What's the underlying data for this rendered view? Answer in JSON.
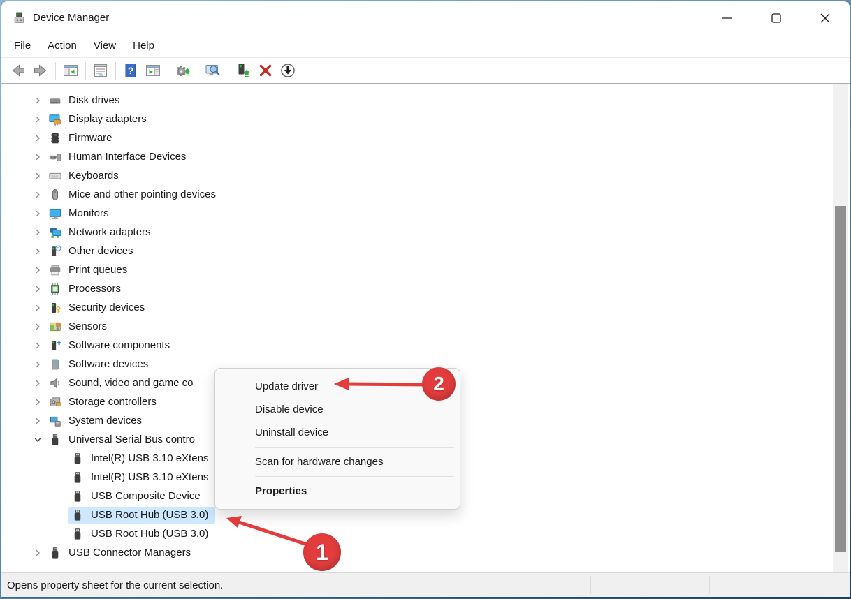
{
  "window": {
    "title": "Device Manager",
    "controls": [
      {
        "name": "minimize"
      },
      {
        "name": "maximize"
      },
      {
        "name": "close"
      }
    ]
  },
  "menu_bar": {
    "items": [
      {
        "label": "File"
      },
      {
        "label": "Action"
      },
      {
        "label": "View"
      },
      {
        "label": "Help"
      }
    ]
  },
  "toolbar": {
    "buttons": [
      {
        "name": "back"
      },
      {
        "name": "forward"
      },
      {
        "sep": true
      },
      {
        "name": "show-console-tree"
      },
      {
        "sep": true
      },
      {
        "name": "properties"
      },
      {
        "sep": true
      },
      {
        "name": "help"
      },
      {
        "name": "show-action-pane"
      },
      {
        "sep": true
      },
      {
        "name": "update-driver-software"
      },
      {
        "sep": true
      },
      {
        "name": "scan-hardware-changes"
      },
      {
        "sep": true
      },
      {
        "name": "update-device-driver"
      },
      {
        "name": "uninstall-device"
      },
      {
        "name": "disable-device"
      }
    ]
  },
  "tree": {
    "items": [
      {
        "label": "Disk drives",
        "icon": "disk-drives",
        "level": 1,
        "chevron": "right"
      },
      {
        "label": "Display adapters",
        "icon": "display-adapters",
        "level": 1,
        "chevron": "right"
      },
      {
        "label": "Firmware",
        "icon": "firmware",
        "level": 1,
        "chevron": "right"
      },
      {
        "label": "Human Interface Devices",
        "icon": "hid",
        "level": 1,
        "chevron": "right"
      },
      {
        "label": "Keyboards",
        "icon": "keyboards",
        "level": 1,
        "chevron": "right"
      },
      {
        "label": "Mice and other pointing devices",
        "icon": "mice",
        "level": 1,
        "chevron": "right"
      },
      {
        "label": "Monitors",
        "icon": "monitors",
        "level": 1,
        "chevron": "right"
      },
      {
        "label": "Network adapters",
        "icon": "network-adapters",
        "level": 1,
        "chevron": "right"
      },
      {
        "label": "Other devices",
        "icon": "other-devices",
        "level": 1,
        "chevron": "right"
      },
      {
        "label": "Print queues",
        "icon": "print-queues",
        "level": 1,
        "chevron": "right"
      },
      {
        "label": "Processors",
        "icon": "processors",
        "level": 1,
        "chevron": "right"
      },
      {
        "label": "Security devices",
        "icon": "security-devices",
        "level": 1,
        "chevron": "right"
      },
      {
        "label": "Sensors",
        "icon": "sensors",
        "level": 1,
        "chevron": "right"
      },
      {
        "label": "Software components",
        "icon": "software-components",
        "level": 1,
        "chevron": "right"
      },
      {
        "label": "Software devices",
        "icon": "software-devices",
        "level": 1,
        "chevron": "right"
      },
      {
        "label": "Sound, video and game co",
        "icon": "sound",
        "level": 1,
        "chevron": "right"
      },
      {
        "label": "Storage controllers",
        "icon": "storage-controllers",
        "level": 1,
        "chevron": "right"
      },
      {
        "label": "System devices",
        "icon": "system-devices",
        "level": 1,
        "chevron": "right"
      },
      {
        "label": "Universal Serial Bus contro",
        "icon": "usb",
        "level": 1,
        "chevron": "down"
      },
      {
        "label": "Intel(R) USB 3.10 eXtens",
        "icon": "usb-device",
        "level": 2,
        "chevron": "none"
      },
      {
        "label": "Intel(R) USB 3.10 eXtens",
        "icon": "usb-device",
        "level": 2,
        "chevron": "none"
      },
      {
        "label": "USB Composite Device",
        "icon": "usb-device",
        "level": 2,
        "chevron": "none"
      },
      {
        "label": "USB Root Hub (USB 3.0)",
        "icon": "usb-device",
        "level": 2,
        "chevron": "none",
        "selected": true
      },
      {
        "label": "USB Root Hub (USB 3.0)",
        "icon": "usb-device",
        "level": 2,
        "chevron": "none"
      },
      {
        "label": "USB Connector Managers",
        "icon": "usb-connector",
        "level": 1,
        "chevron": "right"
      }
    ]
  },
  "context_menu": {
    "items": [
      {
        "label": "Update driver"
      },
      {
        "label": "Disable device"
      },
      {
        "label": "Uninstall device",
        "separator_after": true
      },
      {
        "label": "Scan for hardware changes",
        "separator_after": true
      },
      {
        "label": "Properties",
        "bold": true
      }
    ]
  },
  "status_bar": {
    "text": "Opens property sheet for the current selection."
  },
  "annotations": {
    "badges": [
      {
        "label": "1"
      },
      {
        "label": "2"
      }
    ]
  },
  "colors": {
    "selection_highlight": "#cde8ff",
    "annotation_red": "#e23c3d"
  }
}
